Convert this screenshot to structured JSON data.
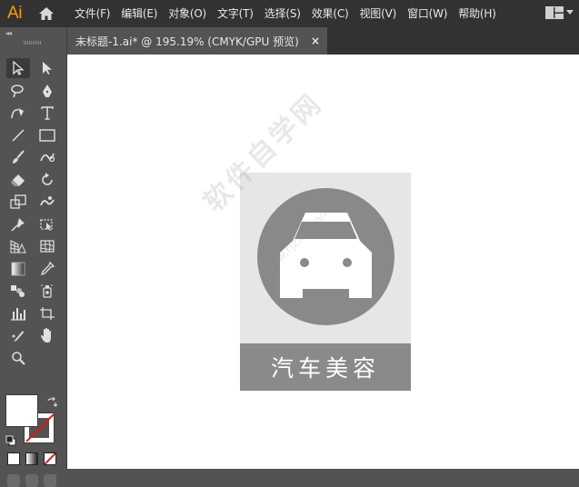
{
  "app": {
    "logo": "Ai"
  },
  "menu": [
    "文件(F)",
    "编辑(E)",
    "对象(O)",
    "文字(T)",
    "选择(S)",
    "效果(C)",
    "视图(V)",
    "窗口(W)",
    "帮助(H)"
  ],
  "tab": {
    "title": "未标题-1.ai* @ 195.19% (CMYK/GPU 预览)",
    "close": "×"
  },
  "toolpanel": {
    "collapse": "◂◂"
  },
  "artwork": {
    "label": "汽车美容"
  },
  "watermark": {
    "text": "软件自学网",
    "sub": "www.rjzxw.com"
  },
  "colors": {
    "accent": "#ff9a00",
    "circle": "#898989",
    "label_bg": "#8a8a8a",
    "artboard_bg": "#e6e6e6"
  }
}
